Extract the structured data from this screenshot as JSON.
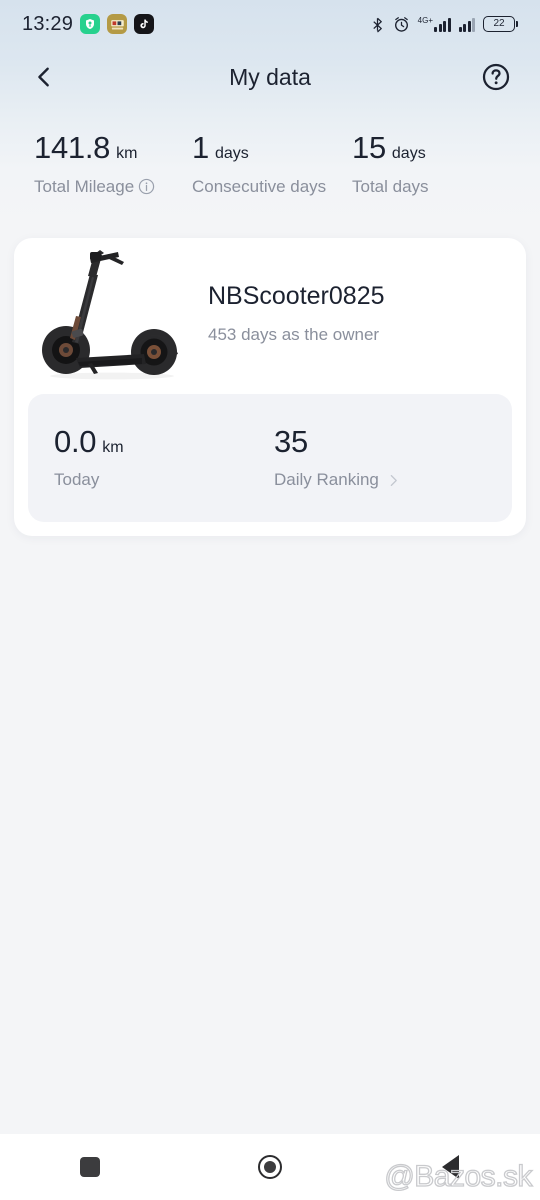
{
  "status_bar": {
    "time": "13:29",
    "app_icons": [
      {
        "name": "shield-location-icon",
        "color": "#27d18e"
      },
      {
        "name": "movie-app-icon",
        "color": "#b49a45",
        "label": "MOVIE"
      },
      {
        "name": "tiktok-icon",
        "color": "#151519"
      }
    ],
    "bluetooth_icon": "bluetooth-icon",
    "alarm_icon": "alarm-clock-icon",
    "network_type": "4G+",
    "battery_percent": "22"
  },
  "header": {
    "back_icon": "back-chevron-icon",
    "title": "My data",
    "help_icon": "help-question-icon"
  },
  "summary": {
    "stats": [
      {
        "value": "141.8",
        "unit": "km",
        "label": "Total Mileage",
        "has_info_icon": true
      },
      {
        "value": "1",
        "unit": "days",
        "label": "Consecutive days",
        "has_info_icon": false
      },
      {
        "value": "15",
        "unit": "days",
        "label": "Total days",
        "has_info_icon": false
      }
    ]
  },
  "device_card": {
    "image_name": "electric-scooter-image",
    "name": "NBScooter0825",
    "ownership": "453 days as the owner",
    "panel": {
      "today": {
        "value": "0.0",
        "unit": "km",
        "label": "Today"
      },
      "ranking": {
        "value": "35",
        "label": "Daily Ranking",
        "chevron": "chevron-right-icon"
      }
    }
  },
  "navbar": {
    "recents_label": "recents-square",
    "home_label": "home-circle",
    "back_label": "back-triangle"
  },
  "watermark": {
    "text": "@Bazos.sk"
  },
  "colors": {
    "top_gradient_start": "#d6e2ed",
    "page_background": "#f4f5f7",
    "card_background": "#ffffff",
    "panel_background": "#f2f3f7",
    "primary_text": "#1c2230",
    "secondary_text": "#8a8f9c"
  }
}
